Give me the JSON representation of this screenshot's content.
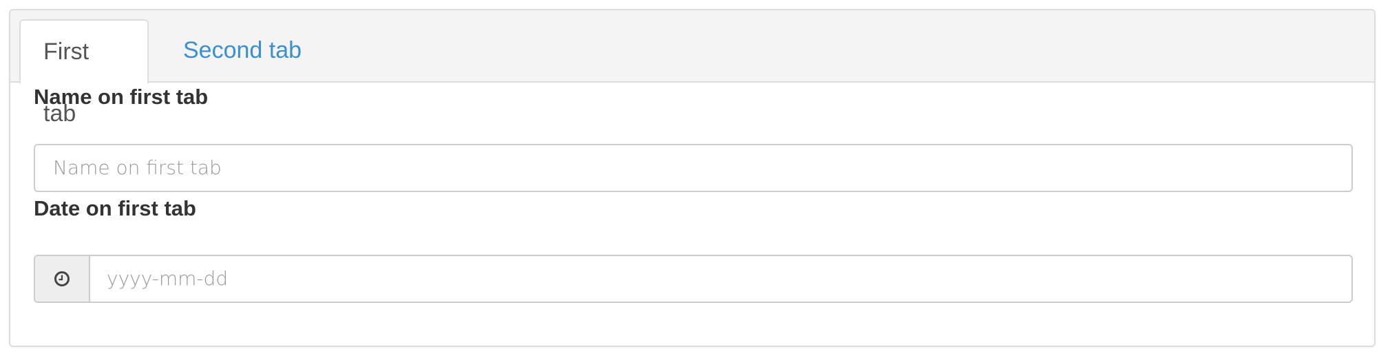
{
  "tabs": [
    {
      "label": "First tab",
      "active": true
    },
    {
      "label": "Second tab",
      "active": false
    }
  ],
  "form": {
    "name_label": "Name on first tab",
    "name_placeholder": "Name on first tab",
    "date_label": "Date on first tab",
    "date_placeholder": "yyyy-mm-dd",
    "date_icon": "clock-icon"
  },
  "colors": {
    "accent": "#3a8fd0"
  }
}
